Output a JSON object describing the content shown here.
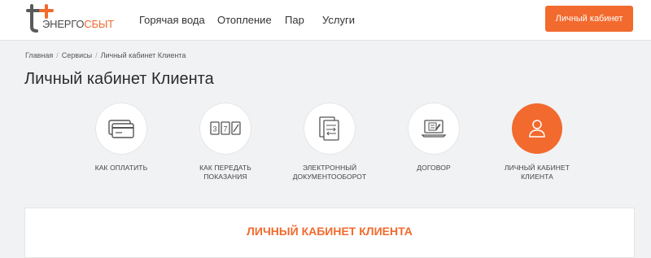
{
  "brand": {
    "logo_prefix": "ЭНЕРГО",
    "logo_suffix": "СБЫТ",
    "accent_color": "#f26a2e"
  },
  "nav": {
    "items": [
      {
        "label": "Горячая вода"
      },
      {
        "label": "Отопление"
      },
      {
        "label": "Пар"
      },
      {
        "label": "Услуги"
      }
    ],
    "cabinet_button": "Личный кабинет"
  },
  "breadcrumb": {
    "items": [
      "Главная",
      "Сервисы",
      "Личный кабинет Клиента"
    ],
    "separator": "/"
  },
  "page": {
    "title": "Личный кабинет Клиента"
  },
  "services": [
    {
      "line1": "КАК ОПЛАТИТЬ",
      "line2": "",
      "icon": "credit-card-icon",
      "active": false
    },
    {
      "line1": "КАК ПЕРЕДАТЬ",
      "line2": "ПОКАЗАНИЯ",
      "icon": "meter-digits-icon",
      "active": false
    },
    {
      "line1": "ЭЛЕКТРОННЫЙ",
      "line2": "ДОКУМЕНТООБОРОТ",
      "icon": "documents-icon",
      "active": false
    },
    {
      "line1": "ДОГОВОР",
      "line2": "",
      "icon": "contract-laptop-icon",
      "active": false
    },
    {
      "line1": "ЛИЧНЫЙ КАБИНЕТ",
      "line2": "КЛИЕНТА",
      "icon": "user-icon",
      "active": true
    }
  ],
  "panel": {
    "title": "ЛИЧНЫЙ КАБИНЕТ КЛИЕНТА"
  }
}
